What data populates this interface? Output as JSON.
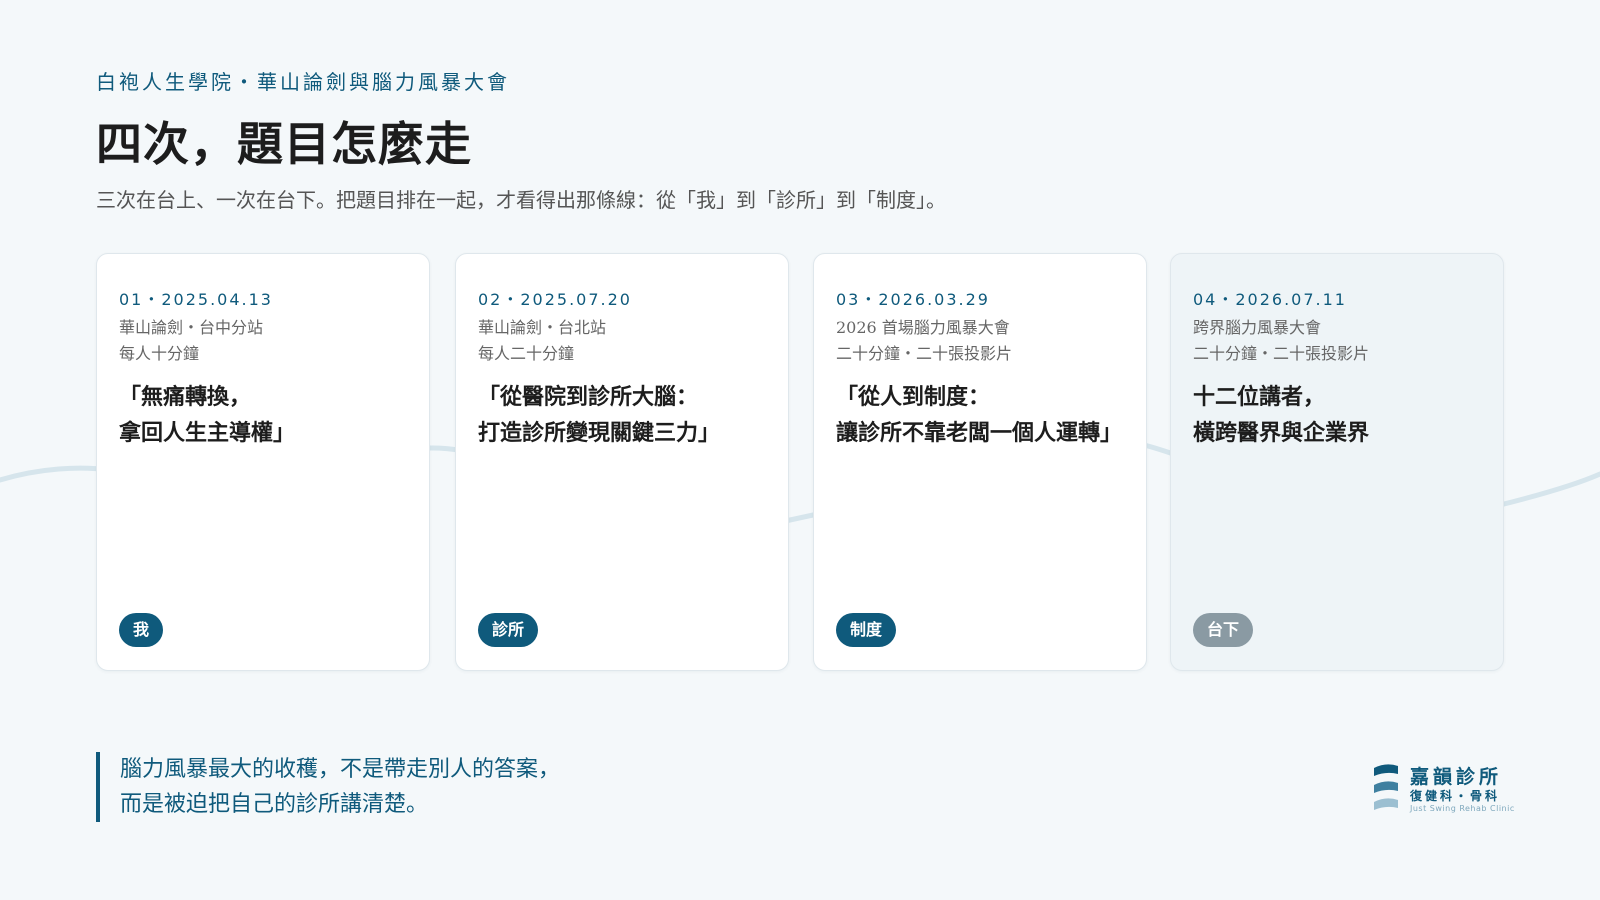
{
  "header": {
    "kicker": "白袍人生學院・華山論劍與腦力風暴大會",
    "title": "四次，題目怎麼走",
    "subtitle": "三次在台上、一次在台下。把題目排在一起，才看得出那條線：從「我」到「診所」到「制度」。"
  },
  "cards": [
    {
      "date": "01・2025.04.13",
      "meta_line1": "華山論劍・台中分站",
      "meta_line2": "每人十分鐘",
      "title_line1": "「無痛轉換，",
      "title_line2": "拿回人生主導權」",
      "tag": "我"
    },
    {
      "date": "02・2025.07.20",
      "meta_line1": "華山論劍・台北站",
      "meta_line2": "每人二十分鐘",
      "title_line1": "「從醫院到診所大腦：",
      "title_line2": "打造診所變現關鍵三力」",
      "tag": "診所"
    },
    {
      "date": "03・2026.03.29",
      "meta_line1": "2026 首場腦力風暴大會",
      "meta_line2": "二十分鐘・二十張投影片",
      "title_line1": "「從人到制度：",
      "title_line2": "讓診所不靠老闆一個人運轉」",
      "tag": "制度"
    },
    {
      "date": "04・2026.07.11",
      "meta_line1": "跨界腦力風暴大會",
      "meta_line2": "二十分鐘・二十張投影片",
      "title_line1": "十二位講者，",
      "title_line2": "橫跨醫界與企業界",
      "tag": "台下"
    }
  ],
  "quote": {
    "line1": "腦力風暴最大的收穫，不是帶走別人的答案，",
    "line2": "而是被迫把自己的診所講清楚。"
  },
  "logo": {
    "name": "嘉韻診所",
    "dept": "復健科・骨科",
    "en": "Just Swing Rehab Clinic"
  },
  "colors": {
    "accent": "#0f5a7c",
    "muted_tag": "#8a9aa3",
    "background": "#f4f8fa"
  }
}
